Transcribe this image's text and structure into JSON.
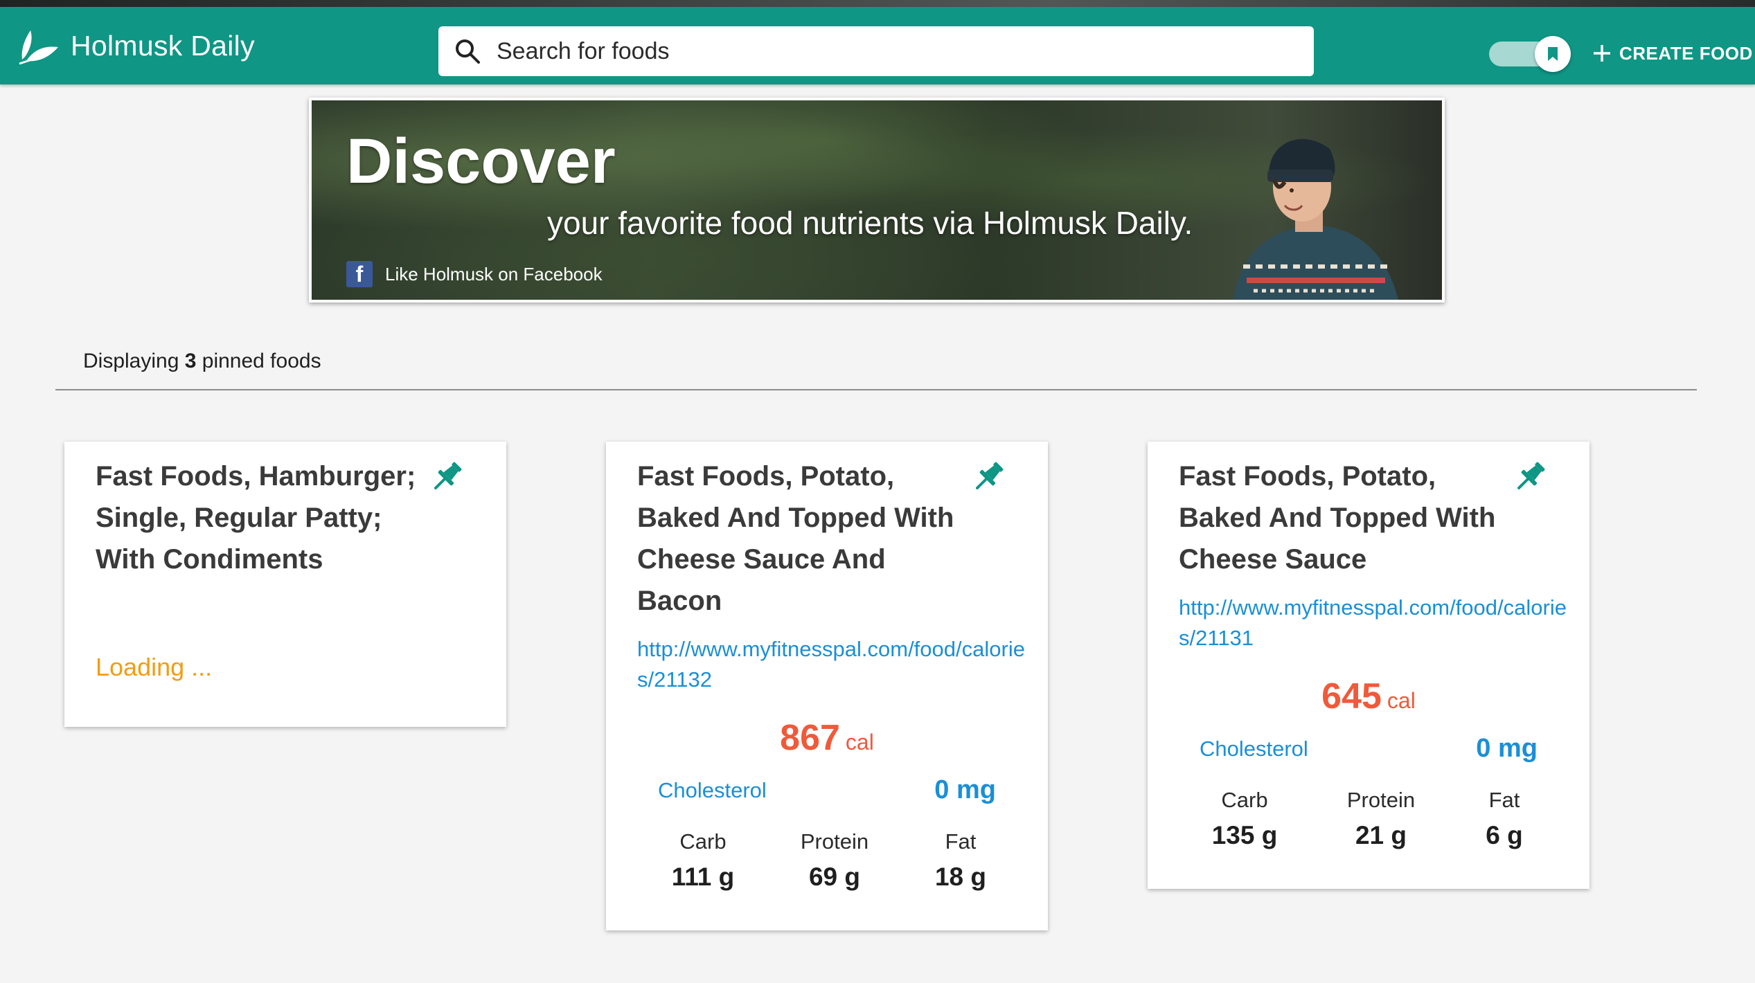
{
  "header": {
    "brand_name": "Holmusk Daily",
    "search_placeholder": "Search for foods",
    "create_food_label": "CREATE FOOD",
    "accent_color": "#0f9685"
  },
  "banner": {
    "title": "Discover",
    "subtitle": "your favorite food nutrients via Holmusk Daily.",
    "facebook_label": "Like Holmusk on Facebook",
    "facebook_letter": "f"
  },
  "summary": {
    "prefix": "Displaying ",
    "count": "3",
    "suffix": " pinned foods"
  },
  "cards": [
    {
      "title": "Fast Foods, Hamburger; Single, Regular Patty; With Condiments",
      "loading": "Loading ..."
    },
    {
      "title": "Fast Foods, Potato, Baked And Topped With Cheese Sauce And Bacon",
      "url": "http://www.myfitnesspal.com/food/calories/21132",
      "calories": "867",
      "cal_unit": "cal",
      "cholesterol_label": "Cholesterol",
      "cholesterol_value": "0 mg",
      "macros": [
        {
          "label": "Carb",
          "value": "111 g"
        },
        {
          "label": "Protein",
          "value": "69 g"
        },
        {
          "label": "Fat",
          "value": "18 g"
        }
      ]
    },
    {
      "title": "Fast Foods, Potato, Baked And Topped With Cheese Sauce",
      "url": "http://www.myfitnesspal.com/food/calories/21131",
      "calories": "645",
      "cal_unit": "cal",
      "cholesterol_label": "Cholesterol",
      "cholesterol_value": "0 mg",
      "macros": [
        {
          "label": "Carb",
          "value": "135 g"
        },
        {
          "label": "Protein",
          "value": "21 g"
        },
        {
          "label": "Fat",
          "value": "6 g"
        }
      ]
    }
  ],
  "icons": {
    "brand": "leaf-logo-icon",
    "search": "search-icon",
    "toggle": "bookmark-toggle",
    "create": "plus-icon",
    "pin": "pin-icon",
    "facebook": "facebook-icon"
  },
  "colors": {
    "calories": "#ef5a3b",
    "link": "#1a8fd6",
    "loading": "#f39c12",
    "pin": "#0f9685"
  }
}
